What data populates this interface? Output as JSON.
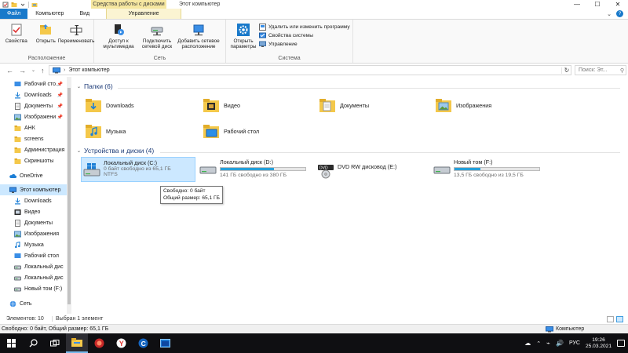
{
  "window": {
    "title": "Этот компьютер",
    "context_group": "Средства работы с дисками"
  },
  "ribbon_tabs": [
    {
      "label": "Файл"
    },
    {
      "label": "Компьютер"
    },
    {
      "label": "Вид"
    },
    {
      "label": "Управление"
    }
  ],
  "ribbon": {
    "location": {
      "label": "Расположение",
      "buttons": [
        "Свойства",
        "Открыть",
        "Переименовать"
      ]
    },
    "network": {
      "label": "Сеть",
      "buttons": [
        "Доступ к мультимедиа",
        "Подключить сетевой диск",
        "Добавить сетевое расположение"
      ]
    },
    "system": {
      "label": "Система",
      "big_button": "Открыть параметры",
      "small_buttons": [
        "Удалить или изменить программу",
        "Свойства системы",
        "Управление"
      ]
    }
  },
  "address": {
    "path": "Этот компьютер",
    "search_placeholder": "Поиск: Эт..."
  },
  "nav_pane": {
    "quick_access": [
      {
        "label": "Рабочий сто...",
        "pinned": true
      },
      {
        "label": "Downloads",
        "pinned": true
      },
      {
        "label": "Документы",
        "pinned": true
      },
      {
        "label": "Изображени",
        "pinned": true
      },
      {
        "label": "АНК",
        "pinned": false
      },
      {
        "label": "screens",
        "pinned": false
      },
      {
        "label": "Администрация",
        "pinned": false
      },
      {
        "label": "Скриншоты",
        "pinned": false
      }
    ],
    "onedrive": "OneDrive",
    "this_pc": "Этот компьютер",
    "this_pc_items": [
      "Downloads",
      "Видео",
      "Документы",
      "Изображения",
      "Музыка",
      "Рабочий стол",
      "Локальный дис",
      "Локальный дис",
      "Новый том (F:)"
    ],
    "network": "Сеть"
  },
  "folders": {
    "header": "Папки (6)",
    "items": [
      "Downloads",
      "Видео",
      "Документы",
      "Изображения",
      "Музыка",
      "Рабочий стол"
    ]
  },
  "drives": {
    "header": "Устройства и диски (4)",
    "items": [
      {
        "name": "Локальный диск (C:)",
        "free": "0 байт свободно из 65,1 ГБ",
        "fs": "NTFS",
        "used_fraction": 1.0
      },
      {
        "name": "Локальный диск (D:)",
        "free": "141 ГБ свободно из 380 ГБ",
        "used_fraction": 0.63
      },
      {
        "name": "DVD RW дисковод (E:)",
        "free": "",
        "used_fraction": null
      },
      {
        "name": "Новый том (F:)",
        "free": "13,5 ГБ свободно из 19,5 ГБ",
        "used_fraction": 0.31
      }
    ]
  },
  "tooltip": {
    "line1": "Свободно: 0 байт",
    "line2": "Общий размер: 65,1 ГБ"
  },
  "status": {
    "count": "Элементов: 10",
    "selected": "Выбран 1 элемент",
    "bottom_left": "Свободно: 0 байт, Общий размер: 65,1 ГБ",
    "bottom_right": "Компьютер"
  },
  "taskbar": {
    "language": "РУС",
    "time": "19:26",
    "date": "25.03.2021"
  },
  "colors": {
    "accent": "#1979ca",
    "selection": "#cce8ff",
    "folder": "#f4c84a",
    "drive_bar": "#26a0da",
    "drive_bar_full": "#da2626"
  }
}
